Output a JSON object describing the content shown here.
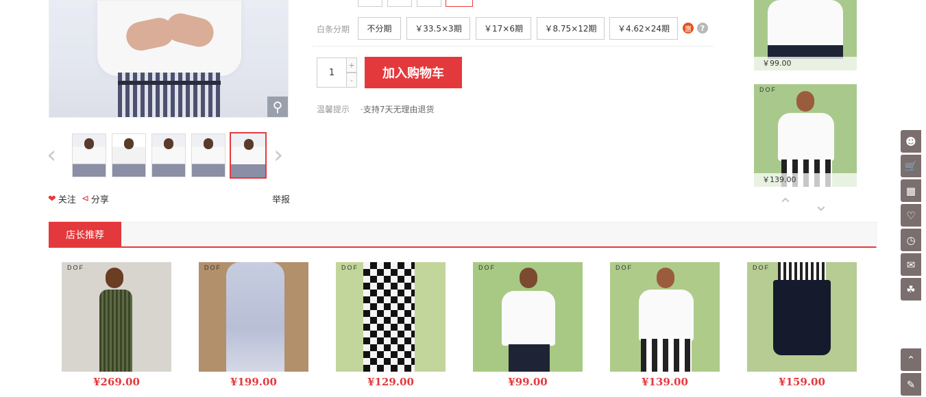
{
  "gallery": {
    "zoom_icon": "magnifier-icon",
    "thumb_count": 5,
    "prev_icon": "chevron-left-icon",
    "next_icon": "chevron-right-icon",
    "follow_label": "关注",
    "share_label": "分享",
    "report_label": "举报"
  },
  "installment": {
    "label": "白条分期",
    "options": [
      "不分期",
      "￥33.5×3期",
      "￥17×6期",
      "￥8.75×12期",
      "￥4.62×24期"
    ],
    "hui_badge": "惠",
    "help_glyph": "?"
  },
  "purchase": {
    "quantity": "1",
    "plus": "+",
    "minus": "-",
    "add_to_cart": "加入购物车",
    "tip_label": "温馨提示",
    "tip_text": "·支持7天无理由退货"
  },
  "side_recommend": {
    "items": [
      {
        "price": "￥99.00"
      },
      {
        "price": "￥139.00"
      }
    ]
  },
  "toolbar": {
    "icons": [
      "user-icon",
      "cart-icon",
      "coupon-icon",
      "heart-icon",
      "history-icon",
      "chat-icon",
      "gift-icon",
      "back-to-top-icon",
      "feedback-icon"
    ]
  },
  "section": {
    "title": "店长推荐",
    "brand": "DOF",
    "products": [
      {
        "price": "¥269.00"
      },
      {
        "price": "¥199.00"
      },
      {
        "price": "¥129.00"
      },
      {
        "price": "¥99.00"
      },
      {
        "price": "¥139.00"
      },
      {
        "price": "¥159.00"
      }
    ]
  }
}
